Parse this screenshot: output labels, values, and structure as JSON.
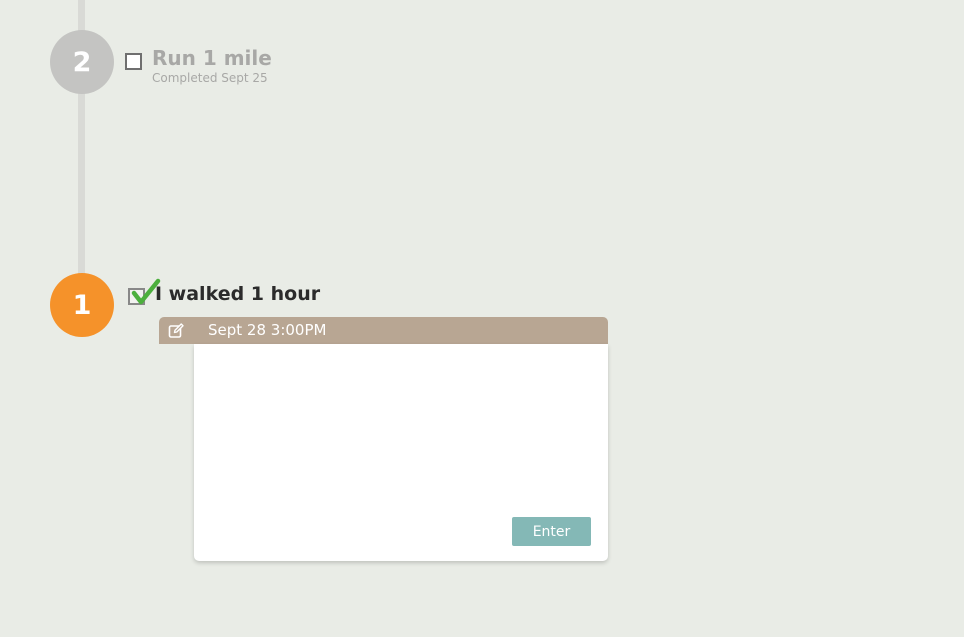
{
  "timeline": {
    "steps": [
      {
        "number": "2",
        "title": "Run 1 mile",
        "subtitle": "Completed Sept 25",
        "checked": false
      },
      {
        "number": "1",
        "title": "I walked 1 hour",
        "checked": true
      }
    ]
  },
  "entry": {
    "date": "Sept 28 3:00PM",
    "text_value": "",
    "enter_label": "Enter",
    "icon": "edit-icon"
  },
  "colors": {
    "background": "#e9ece6",
    "step_active": "#f5922a",
    "step_inactive": "#c4c4c2",
    "entry_header": "#b8a693",
    "enter_button": "#84b8b6",
    "check_mark": "#4caf3d"
  }
}
